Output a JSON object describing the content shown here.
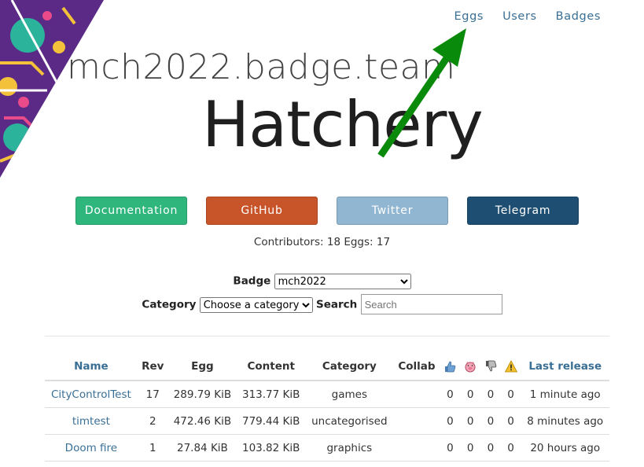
{
  "nav": {
    "items": [
      "Eggs",
      "Users",
      "Badges"
    ]
  },
  "header": {
    "site": "mch2022.badge.team",
    "title": "Hatchery"
  },
  "buttons": [
    {
      "label": "Documentation",
      "color": "#2fb67c"
    },
    {
      "label": "GitHub",
      "color": "#c8542a"
    },
    {
      "label": "Twitter",
      "color": "#90b6d2"
    },
    {
      "label": "Telegram",
      "color": "#1e4e72"
    }
  ],
  "stats": {
    "text": "Contributors: 18 Eggs: 17"
  },
  "filters": {
    "badge_label": "Badge",
    "badge_value": "mch2022",
    "category_label": "Category",
    "category_value": "Choose a category",
    "search_label": "Search",
    "search_placeholder": "Search"
  },
  "table": {
    "headers": [
      "Name",
      "Rev",
      "Egg",
      "Content",
      "Category",
      "Collab",
      "",
      "",
      "",
      "",
      "Last release"
    ],
    "icons": [
      "thumbs-up-icon",
      "pig-icon",
      "thumbs-down-icon",
      "warning-icon"
    ],
    "rows": [
      {
        "name": "CityControlTest",
        "rev": "17",
        "egg": "289.79 KiB",
        "content": "313.77 KiB",
        "category": "games",
        "collab": "",
        "c1": "0",
        "c2": "0",
        "c3": "0",
        "c4": "0",
        "last": "1 minute ago"
      },
      {
        "name": "timtest",
        "rev": "2",
        "egg": "472.46 KiB",
        "content": "779.44 KiB",
        "category": "uncategorised",
        "collab": "",
        "c1": "0",
        "c2": "0",
        "c3": "0",
        "c4": "0",
        "last": "8 minutes ago"
      },
      {
        "name": "Doom fire",
        "rev": "1",
        "egg": "27.84 KiB",
        "content": "103.82 KiB",
        "category": "graphics",
        "collab": "",
        "c1": "0",
        "c2": "0",
        "c3": "0",
        "c4": "0",
        "last": "20 hours ago"
      }
    ]
  }
}
